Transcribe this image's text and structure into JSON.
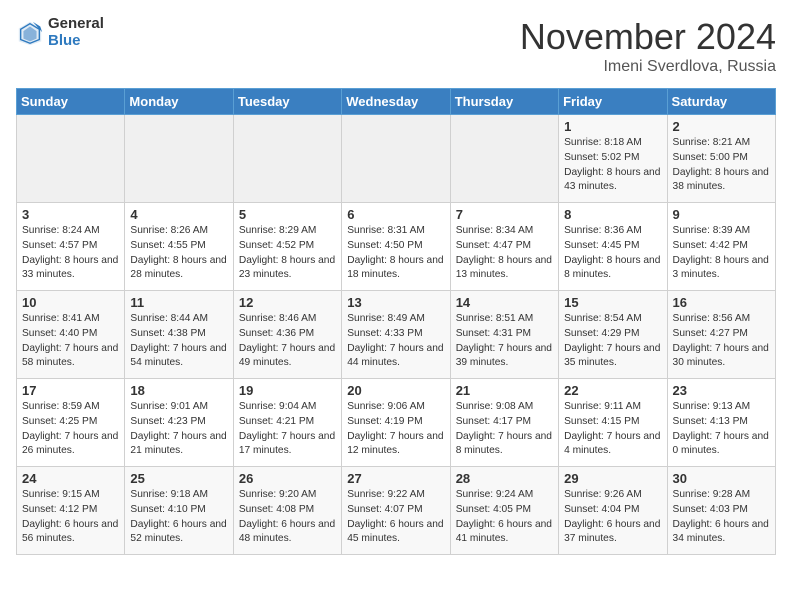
{
  "header": {
    "logo_general": "General",
    "logo_blue": "Blue",
    "month": "November 2024",
    "location": "Imeni Sverdlova, Russia"
  },
  "days_of_week": [
    "Sunday",
    "Monday",
    "Tuesday",
    "Wednesday",
    "Thursday",
    "Friday",
    "Saturday"
  ],
  "weeks": [
    [
      {
        "day": "",
        "info": ""
      },
      {
        "day": "",
        "info": ""
      },
      {
        "day": "",
        "info": ""
      },
      {
        "day": "",
        "info": ""
      },
      {
        "day": "",
        "info": ""
      },
      {
        "day": "1",
        "info": "Sunrise: 8:18 AM\nSunset: 5:02 PM\nDaylight: 8 hours and 43 minutes."
      },
      {
        "day": "2",
        "info": "Sunrise: 8:21 AM\nSunset: 5:00 PM\nDaylight: 8 hours and 38 minutes."
      }
    ],
    [
      {
        "day": "3",
        "info": "Sunrise: 8:24 AM\nSunset: 4:57 PM\nDaylight: 8 hours and 33 minutes."
      },
      {
        "day": "4",
        "info": "Sunrise: 8:26 AM\nSunset: 4:55 PM\nDaylight: 8 hours and 28 minutes."
      },
      {
        "day": "5",
        "info": "Sunrise: 8:29 AM\nSunset: 4:52 PM\nDaylight: 8 hours and 23 minutes."
      },
      {
        "day": "6",
        "info": "Sunrise: 8:31 AM\nSunset: 4:50 PM\nDaylight: 8 hours and 18 minutes."
      },
      {
        "day": "7",
        "info": "Sunrise: 8:34 AM\nSunset: 4:47 PM\nDaylight: 8 hours and 13 minutes."
      },
      {
        "day": "8",
        "info": "Sunrise: 8:36 AM\nSunset: 4:45 PM\nDaylight: 8 hours and 8 minutes."
      },
      {
        "day": "9",
        "info": "Sunrise: 8:39 AM\nSunset: 4:42 PM\nDaylight: 8 hours and 3 minutes."
      }
    ],
    [
      {
        "day": "10",
        "info": "Sunrise: 8:41 AM\nSunset: 4:40 PM\nDaylight: 7 hours and 58 minutes."
      },
      {
        "day": "11",
        "info": "Sunrise: 8:44 AM\nSunset: 4:38 PM\nDaylight: 7 hours and 54 minutes."
      },
      {
        "day": "12",
        "info": "Sunrise: 8:46 AM\nSunset: 4:36 PM\nDaylight: 7 hours and 49 minutes."
      },
      {
        "day": "13",
        "info": "Sunrise: 8:49 AM\nSunset: 4:33 PM\nDaylight: 7 hours and 44 minutes."
      },
      {
        "day": "14",
        "info": "Sunrise: 8:51 AM\nSunset: 4:31 PM\nDaylight: 7 hours and 39 minutes."
      },
      {
        "day": "15",
        "info": "Sunrise: 8:54 AM\nSunset: 4:29 PM\nDaylight: 7 hours and 35 minutes."
      },
      {
        "day": "16",
        "info": "Sunrise: 8:56 AM\nSunset: 4:27 PM\nDaylight: 7 hours and 30 minutes."
      }
    ],
    [
      {
        "day": "17",
        "info": "Sunrise: 8:59 AM\nSunset: 4:25 PM\nDaylight: 7 hours and 26 minutes."
      },
      {
        "day": "18",
        "info": "Sunrise: 9:01 AM\nSunset: 4:23 PM\nDaylight: 7 hours and 21 minutes."
      },
      {
        "day": "19",
        "info": "Sunrise: 9:04 AM\nSunset: 4:21 PM\nDaylight: 7 hours and 17 minutes."
      },
      {
        "day": "20",
        "info": "Sunrise: 9:06 AM\nSunset: 4:19 PM\nDaylight: 7 hours and 12 minutes."
      },
      {
        "day": "21",
        "info": "Sunrise: 9:08 AM\nSunset: 4:17 PM\nDaylight: 7 hours and 8 minutes."
      },
      {
        "day": "22",
        "info": "Sunrise: 9:11 AM\nSunset: 4:15 PM\nDaylight: 7 hours and 4 minutes."
      },
      {
        "day": "23",
        "info": "Sunrise: 9:13 AM\nSunset: 4:13 PM\nDaylight: 7 hours and 0 minutes."
      }
    ],
    [
      {
        "day": "24",
        "info": "Sunrise: 9:15 AM\nSunset: 4:12 PM\nDaylight: 6 hours and 56 minutes."
      },
      {
        "day": "25",
        "info": "Sunrise: 9:18 AM\nSunset: 4:10 PM\nDaylight: 6 hours and 52 minutes."
      },
      {
        "day": "26",
        "info": "Sunrise: 9:20 AM\nSunset: 4:08 PM\nDaylight: 6 hours and 48 minutes."
      },
      {
        "day": "27",
        "info": "Sunrise: 9:22 AM\nSunset: 4:07 PM\nDaylight: 6 hours and 45 minutes."
      },
      {
        "day": "28",
        "info": "Sunrise: 9:24 AM\nSunset: 4:05 PM\nDaylight: 6 hours and 41 minutes."
      },
      {
        "day": "29",
        "info": "Sunrise: 9:26 AM\nSunset: 4:04 PM\nDaylight: 6 hours and 37 minutes."
      },
      {
        "day": "30",
        "info": "Sunrise: 9:28 AM\nSunset: 4:03 PM\nDaylight: 6 hours and 34 minutes."
      }
    ]
  ]
}
